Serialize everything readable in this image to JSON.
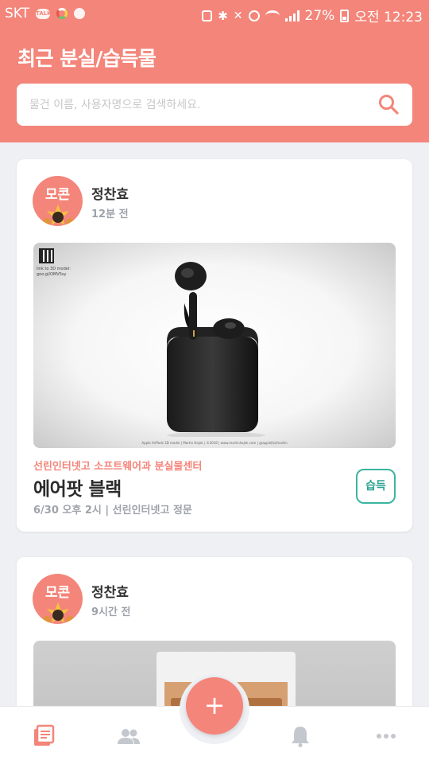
{
  "colors": {
    "accent": "#f4857a",
    "teal": "#3bb5a0",
    "muted": "#9ea3aa",
    "background": "#eef0f4"
  },
  "status_bar": {
    "carrier": "SKT",
    "talk_badge": "TALK",
    "battery": "27%",
    "time": "오전 12:23"
  },
  "header": {
    "title": "최근 분실/습득물",
    "search_placeholder": "물건 이름, 사용자명으로 검색하세요."
  },
  "posts": [
    {
      "user": "정찬효",
      "avatar_text": "모콘",
      "time_ago": "12분 전",
      "image": {
        "caption": "link to 3D model: goo.gl/OMV5sy",
        "footer": "Apple AirPods 3D model | Martin Hajek | ©2016 | www.martinhajek.com | @apple[to]martin"
      },
      "location": "선린인터넷고 소프트웨어과 분실물센터",
      "item_name": "에어팟 블랙",
      "meta": "6/30 오후 2시 | 선린인터넷고 정문",
      "badge": "습득"
    },
    {
      "user": "정찬효",
      "avatar_text": "모콘",
      "time_ago": "9시간 전"
    }
  ],
  "nav": {
    "items": [
      "list-icon",
      "people-icon",
      "add-icon",
      "bell-icon",
      "more-icon"
    ],
    "fab_label": "+"
  }
}
